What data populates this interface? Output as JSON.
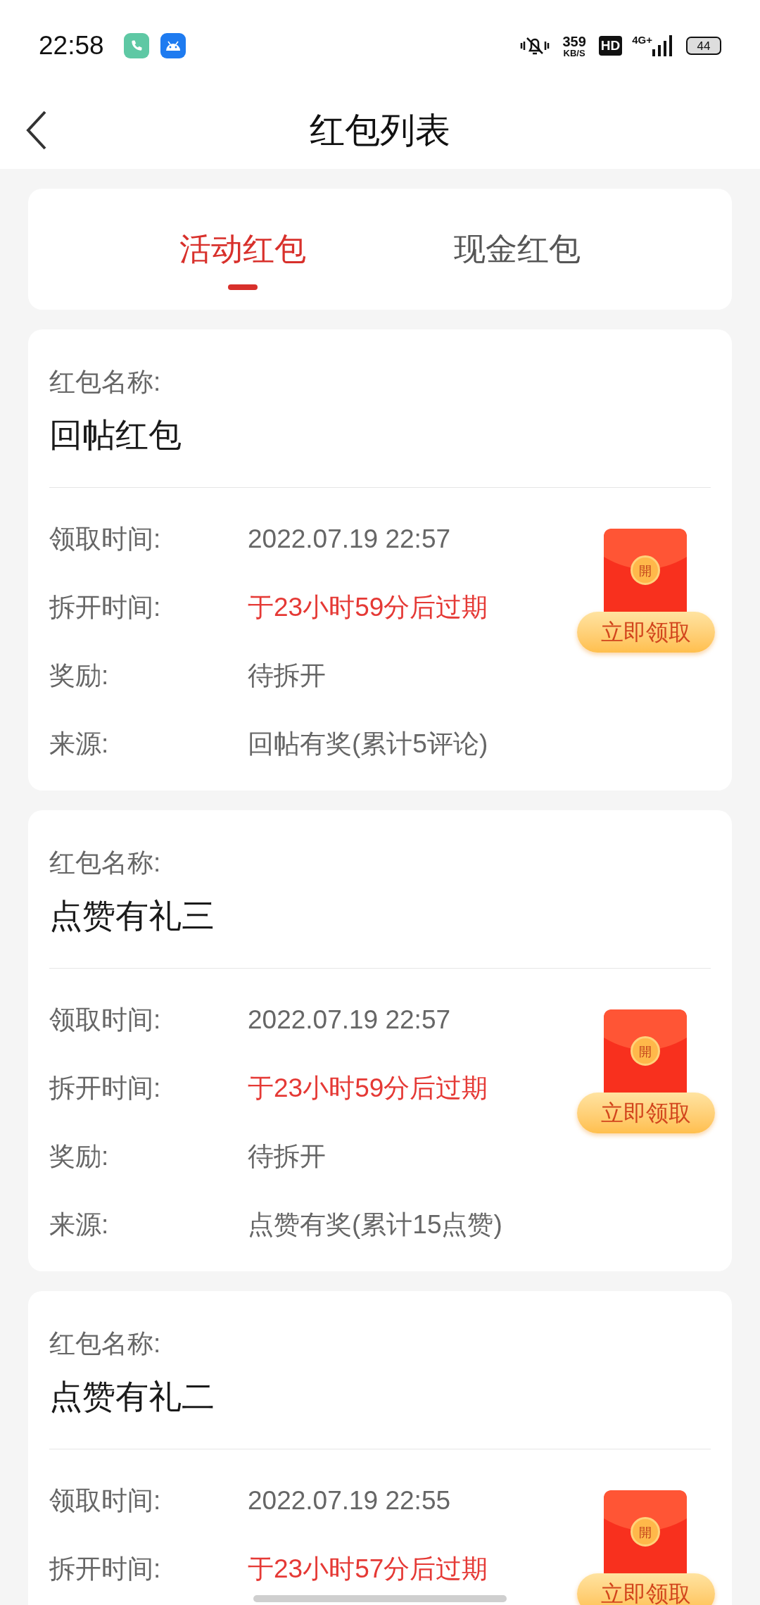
{
  "status_bar": {
    "time": "22:58",
    "speed": "359",
    "speed_unit": "KB/S",
    "hd": "HD",
    "network": "4G+",
    "battery": "44"
  },
  "header": {
    "title": "红包列表"
  },
  "tabs": [
    {
      "label": "活动红包",
      "selected": true
    },
    {
      "label": "现金红包",
      "selected": false
    }
  ],
  "cards": [
    {
      "name_label": "红包名称:",
      "name": "回帖红包",
      "seal": "開",
      "button": "立即领取",
      "rows": [
        {
          "label": "领取时间:",
          "value": "2022.07.19 22:57",
          "kind": "normal"
        },
        {
          "label": "拆开时间:",
          "value": "于23小时59分后过期",
          "kind": "alert"
        },
        {
          "label": "奖励:",
          "value": "待拆开",
          "kind": "normal"
        },
        {
          "label": "来源:",
          "value": "回帖有奖(累计5评论)",
          "kind": "normal"
        }
      ]
    },
    {
      "name_label": "红包名称:",
      "name": "点赞有礼三",
      "seal": "開",
      "button": "立即领取",
      "rows": [
        {
          "label": "领取时间:",
          "value": "2022.07.19 22:57",
          "kind": "normal"
        },
        {
          "label": "拆开时间:",
          "value": "于23小时59分后过期",
          "kind": "alert"
        },
        {
          "label": "奖励:",
          "value": "待拆开",
          "kind": "normal"
        },
        {
          "label": "来源:",
          "value": "点赞有奖(累计15点赞)",
          "kind": "normal"
        }
      ]
    },
    {
      "name_label": "红包名称:",
      "name": "点赞有礼二",
      "seal": "開",
      "button": "立即领取",
      "rows": [
        {
          "label": "领取时间:",
          "value": "2022.07.19 22:55",
          "kind": "normal"
        },
        {
          "label": "拆开时间:",
          "value": "于23小时57分后过期",
          "kind": "alert"
        }
      ]
    }
  ]
}
